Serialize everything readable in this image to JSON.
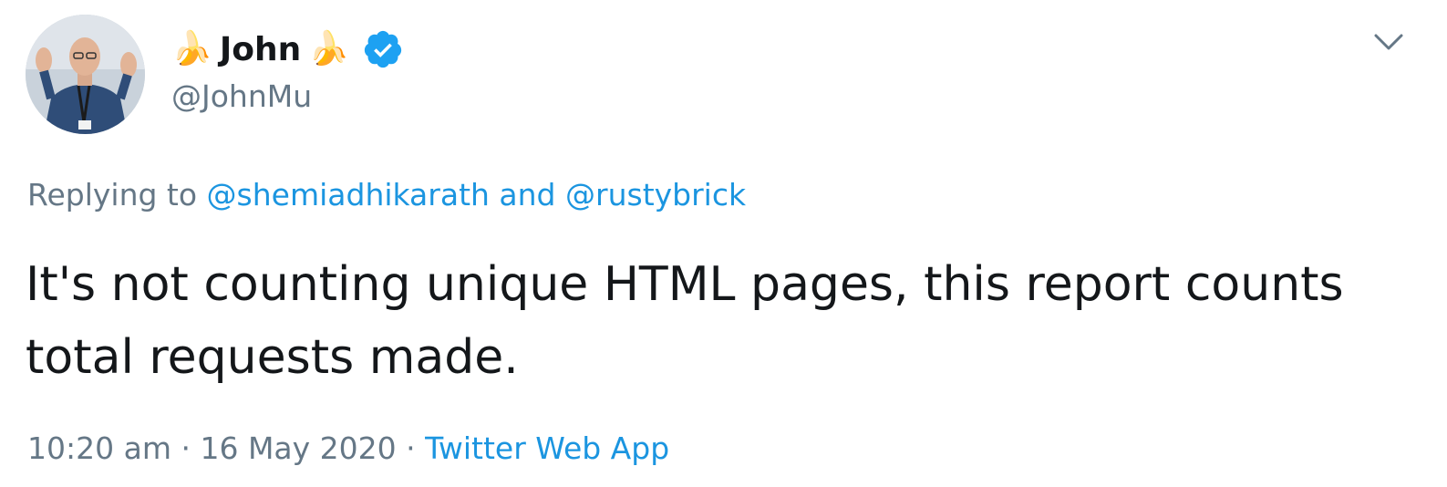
{
  "tweet": {
    "author": {
      "display_name": "John",
      "name_emoji": "🍌",
      "handle": "@JohnMu",
      "verified": true
    },
    "reply": {
      "prefix": "Replying to",
      "mention1": "@shemiadhikarath",
      "conjunction": "and",
      "mention2": "@rustybrick"
    },
    "text": "It's not counting unique HTML pages, this report counts total requests made.",
    "time": "10:20 am",
    "separator": "·",
    "date": "16 May 2020",
    "source": "Twitter Web App"
  },
  "colors": {
    "accent": "#1b95e0",
    "verified": "#1da1f2",
    "muted": "#657786",
    "text": "#14171a"
  },
  "icons": {
    "verified": "verified-badge-icon",
    "menu": "chevron-down-icon"
  }
}
